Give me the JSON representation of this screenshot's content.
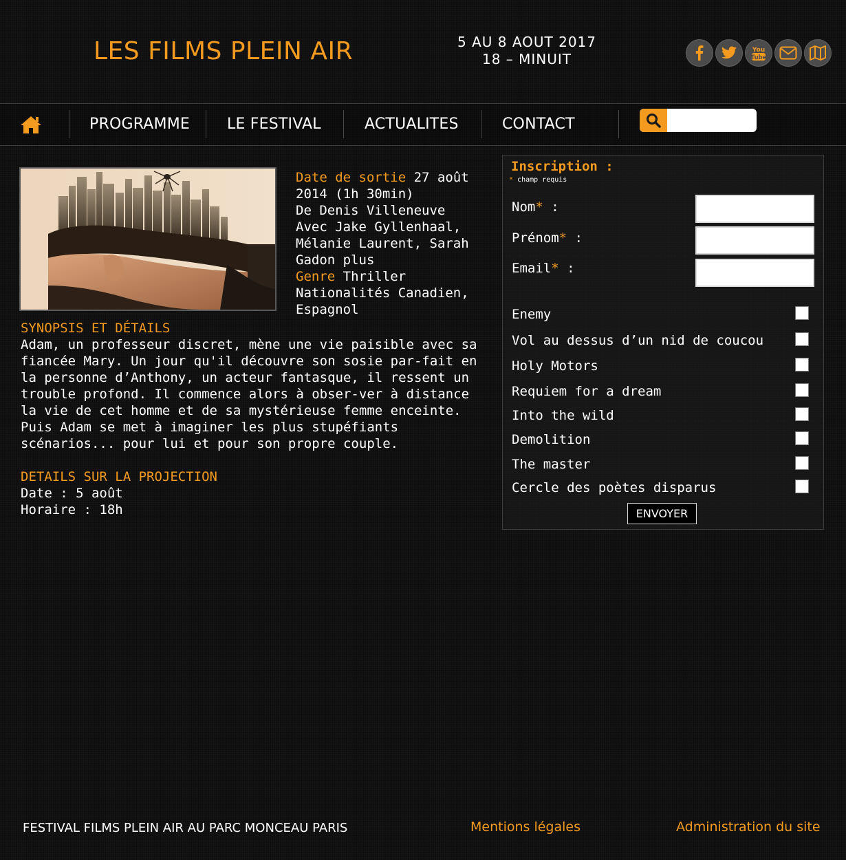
{
  "header": {
    "site_title": "LES FILMS PLEIN AIR",
    "dates_line1": "5 AU 8 AOUT 2017",
    "dates_line2": "18 – MINUIT",
    "social_icons": [
      "facebook-icon",
      "twitter-icon",
      "youtube-icon",
      "mail-icon",
      "map-icon"
    ]
  },
  "nav": {
    "home_icon": "home-icon",
    "items": [
      "PROGRAMME",
      "LE FESTIVAL",
      "ACTUALITES",
      "CONTACT"
    ],
    "search_icon": "search-icon",
    "search_value": ""
  },
  "film": {
    "release_label": "Date de sortie",
    "release_value": " 27 août 2014 (1h 30min)",
    "director": "De Denis Villeneuve",
    "cast": "Avec Jake Gyllenhaal, Mélanie Laurent, Sarah Gadon plus",
    "genre_label": "Genre",
    "genre_value": " Thriller",
    "nationality": "Nationalités Canadien, Espagnol",
    "synopsis_title": "SYNOPSIS ET DÉTAILS",
    "synopsis": "Adam, un professeur discret, mène une vie paisible avec sa fiancée Mary. Un jour qu'il découvre son sosie par-fait en la personne d’Anthony, un acteur fantasque, il ressent un trouble profond. Il commence alors à obser-ver à distance la vie de cet homme et de sa mystérieuse femme enceinte. Puis Adam se met à imaginer les plus stupéfiants scénarios... pour lui et pour son propre couple.",
    "projection_title": "DETAILS SUR LA PROJECTION",
    "projection_date": "Date : 5 août",
    "projection_time": "Horaire : 18h"
  },
  "form": {
    "title": "Inscription :",
    "hint_star": "*",
    "hint_text": " champ requis",
    "fields": [
      {
        "label": "Nom",
        "star": "*",
        "suffix": " :",
        "value": ""
      },
      {
        "label": "Prénom",
        "star": "*",
        "suffix": " :",
        "value": ""
      },
      {
        "label": "Email",
        "star": "*",
        "suffix": " :",
        "value": ""
      }
    ],
    "films": [
      "Enemy",
      "Vol au dessus d’un nid de coucou",
      "Holy Motors",
      "Requiem for a dream",
      "Into the wild",
      "Demolition",
      "The master",
      "Cercle des poètes disparus"
    ],
    "submit_label": "ENVOYER"
  },
  "footer": {
    "left_text": "FESTIVAL FILMS PLEIN AIR AU PARC MONCEAU PARIS",
    "legal_link": "Mentions légales",
    "admin_link": "Administration du site"
  },
  "colors": {
    "accent": "#f39a1f",
    "background": "#0f0f0f",
    "text": "#ffffff"
  }
}
